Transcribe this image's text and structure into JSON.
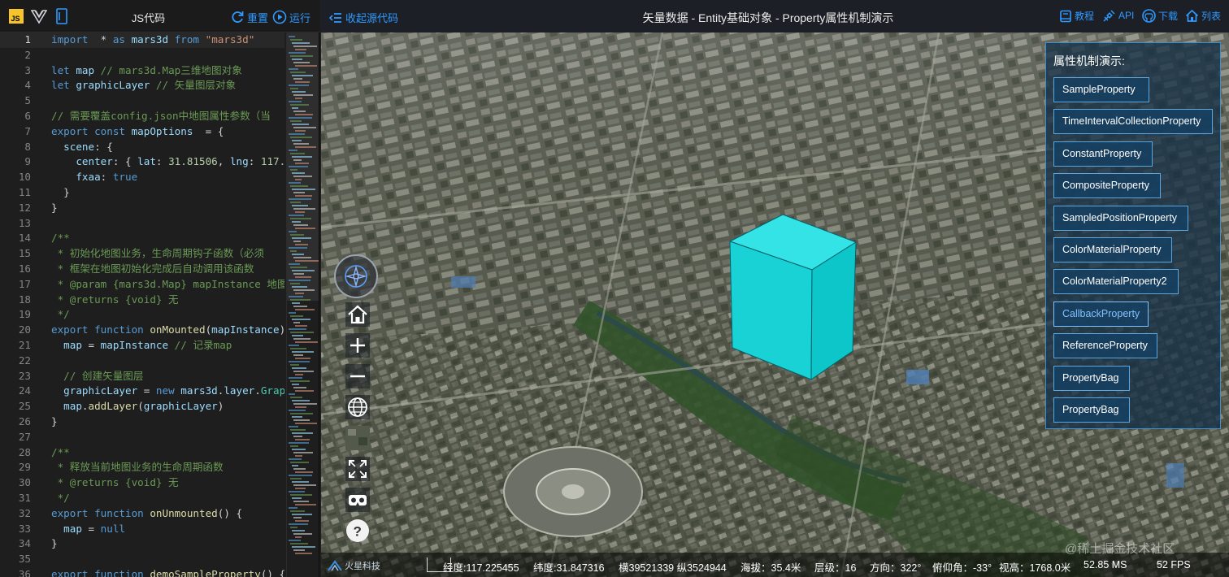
{
  "code_panel": {
    "title": "JS代码",
    "reset_label": "重置",
    "run_label": "运行",
    "colors": {
      "accent": "#2f9aff",
      "background": "#1e1e1e"
    },
    "icons": [
      "js-file-icon",
      "vue-logo-icon",
      "file-icon"
    ],
    "lines": [
      {
        "n": "1",
        "tokens": [
          [
            "k",
            "import"
          ],
          [
            "",
            "  * "
          ],
          [
            "k",
            "as"
          ],
          [
            "v",
            " mars3d "
          ],
          [
            "k",
            "from"
          ],
          [
            "s",
            " \"mars3d\""
          ]
        ]
      },
      {
        "n": "2",
        "tokens": []
      },
      {
        "n": "3",
        "tokens": [
          [
            "k",
            "let"
          ],
          [
            "v",
            " map "
          ],
          [
            "c",
            "// mars3d.Map三维地图对象"
          ]
        ]
      },
      {
        "n": "4",
        "tokens": [
          [
            "k",
            "let"
          ],
          [
            "v",
            " graphicLayer "
          ],
          [
            "c",
            "// 矢量图层对象"
          ]
        ]
      },
      {
        "n": "5",
        "tokens": []
      },
      {
        "n": "6",
        "tokens": [
          [
            "c",
            "// 需要覆盖config.json中地图属性参数（当"
          ]
        ]
      },
      {
        "n": "7",
        "tokens": [
          [
            "k",
            "export"
          ],
          [
            "k",
            " const"
          ],
          [
            "v",
            " mapOptions "
          ],
          [
            "",
            " = {"
          ]
        ]
      },
      {
        "n": "8",
        "tokens": [
          [
            "v",
            "  scene"
          ],
          [
            "",
            ": {"
          ]
        ]
      },
      {
        "n": "9",
        "tokens": [
          [
            "v",
            "    center"
          ],
          [
            "",
            ": { "
          ],
          [
            "v",
            "lat"
          ],
          [
            "",
            ": "
          ],
          [
            "n",
            "31.81506"
          ],
          [
            "",
            ", "
          ],
          [
            "v",
            "lng"
          ],
          [
            "",
            ": "
          ],
          [
            "n",
            "117."
          ]
        ]
      },
      {
        "n": "10",
        "tokens": [
          [
            "v",
            "    fxaa"
          ],
          [
            "",
            ": "
          ],
          [
            "k",
            "true"
          ]
        ]
      },
      {
        "n": "11",
        "tokens": [
          [
            "",
            "  }"
          ]
        ]
      },
      {
        "n": "12",
        "tokens": [
          [
            "",
            "}"
          ]
        ]
      },
      {
        "n": "13",
        "tokens": []
      },
      {
        "n": "14",
        "tokens": [
          [
            "c",
            "/**"
          ]
        ]
      },
      {
        "n": "15",
        "tokens": [
          [
            "c",
            " * 初始化地图业务，生命周期钩子函数（必须"
          ]
        ]
      },
      {
        "n": "16",
        "tokens": [
          [
            "c",
            " * 框架在地图初始化完成后自动调用该函数"
          ]
        ]
      },
      {
        "n": "17",
        "tokens": [
          [
            "c",
            " * @param {mars3d.Map} mapInstance 地图"
          ]
        ]
      },
      {
        "n": "18",
        "tokens": [
          [
            "c",
            " * @returns {void} 无"
          ]
        ]
      },
      {
        "n": "19",
        "tokens": [
          [
            "c",
            " */"
          ]
        ]
      },
      {
        "n": "20",
        "tokens": [
          [
            "k",
            "export"
          ],
          [
            "k",
            " function"
          ],
          [
            "f",
            " onMounted"
          ],
          [
            "",
            "("
          ],
          [
            "v",
            "mapInstance"
          ],
          [
            "",
            ") {"
          ]
        ]
      },
      {
        "n": "21",
        "tokens": [
          [
            "v",
            "  map"
          ],
          [
            "",
            " = "
          ],
          [
            "v",
            "mapInstance "
          ],
          [
            "c",
            "// 记录map"
          ]
        ]
      },
      {
        "n": "22",
        "tokens": []
      },
      {
        "n": "23",
        "tokens": [
          [
            "c",
            "  // 创建矢量图层"
          ]
        ]
      },
      {
        "n": "24",
        "tokens": [
          [
            "v",
            "  graphicLayer"
          ],
          [
            "",
            " = "
          ],
          [
            "k",
            "new"
          ],
          [
            "v",
            " mars3d"
          ],
          [
            "",
            "."
          ],
          [
            "v",
            "layer"
          ],
          [
            "",
            "."
          ],
          [
            "t",
            "Grap"
          ]
        ]
      },
      {
        "n": "25",
        "tokens": [
          [
            "v",
            "  map"
          ],
          [
            "",
            "."
          ],
          [
            "f",
            "addLayer"
          ],
          [
            "",
            "("
          ],
          [
            "v",
            "graphicLayer"
          ],
          [
            "",
            ")"
          ]
        ]
      },
      {
        "n": "26",
        "tokens": [
          [
            "",
            "}"
          ]
        ]
      },
      {
        "n": "27",
        "tokens": []
      },
      {
        "n": "28",
        "tokens": [
          [
            "c",
            "/**"
          ]
        ]
      },
      {
        "n": "29",
        "tokens": [
          [
            "c",
            " * 释放当前地图业务的生命周期函数"
          ]
        ]
      },
      {
        "n": "30",
        "tokens": [
          [
            "c",
            " * @returns {void} 无"
          ]
        ]
      },
      {
        "n": "31",
        "tokens": [
          [
            "c",
            " */"
          ]
        ]
      },
      {
        "n": "32",
        "tokens": [
          [
            "k",
            "export"
          ],
          [
            "k",
            " function"
          ],
          [
            "f",
            " onUnmounted"
          ],
          [
            "",
            "() {"
          ]
        ]
      },
      {
        "n": "33",
        "tokens": [
          [
            "v",
            "  map"
          ],
          [
            "",
            " = "
          ],
          [
            "k",
            "null"
          ]
        ]
      },
      {
        "n": "34",
        "tokens": [
          [
            "",
            "}"
          ]
        ]
      },
      {
        "n": "35",
        "tokens": []
      },
      {
        "n": "36",
        "tokens": [
          [
            "k",
            "export"
          ],
          [
            "k",
            " function"
          ],
          [
            "f",
            " demoSampleProperty"
          ],
          [
            "",
            "() {"
          ]
        ]
      }
    ]
  },
  "map_header": {
    "collapse_label": "收起源代码",
    "title": "矢量数据 - Entity基础对象 - Property属性机制演示",
    "links": [
      {
        "label": "教程",
        "icon": "book-icon"
      },
      {
        "label": "API",
        "icon": "satellite-icon"
      },
      {
        "label": "下载",
        "icon": "github-icon"
      },
      {
        "label": "列表",
        "icon": "home-icon"
      }
    ]
  },
  "map_tools": [
    {
      "name": "compass-icon"
    },
    {
      "name": "home-view-icon"
    },
    {
      "name": "zoom-in-icon"
    },
    {
      "name": "zoom-out-icon"
    },
    {
      "name": "globe-icon"
    },
    {
      "name": "basemap-thumbnail"
    },
    {
      "name": "fullscreen-icon"
    },
    {
      "name": "vr-icon"
    },
    {
      "name": "help-icon"
    }
  ],
  "property_panel": {
    "title": "属性机制演示:",
    "hovered_index": 7,
    "buttons": [
      "SampleProperty",
      "TimeIntervalCollectionProperty",
      "ConstantProperty",
      "CompositeProperty",
      "SampledPositionProperty",
      "ColorMaterialProperty",
      "ColorMaterialProperty2",
      "CallbackProperty",
      "ReferenceProperty",
      "PropertyBag",
      "PropertyBag"
    ]
  },
  "status_bar": {
    "logo_text": "火星科技",
    "lng": "经度:117.225455",
    "lat": "纬度:31.847316",
    "proj": "横39521339 纵3524944",
    "alt": "海拔：35.4米",
    "level": "层级：16",
    "heading": "方向：322°",
    "pitch": "俯仰角：-33°",
    "camera_height": "视高：1768.0米",
    "ms": "52.85 MS",
    "fps": "52 FPS"
  },
  "watermark": "@稀土掘金技术社区",
  "box_color": "#0cd3d6"
}
